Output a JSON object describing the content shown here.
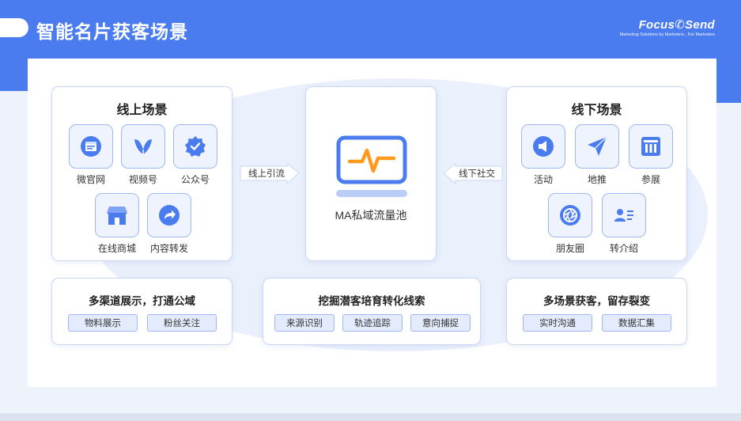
{
  "header": {
    "title": "智能名片获客场景",
    "brand": "Focus✆Send",
    "brand_tagline": "Marketing Solutions by Marketers , For Marketers"
  },
  "online": {
    "title": "线上场景",
    "items": [
      {
        "label": "微官网",
        "icon": "browser-icon"
      },
      {
        "label": "视频号",
        "icon": "butterfly-icon"
      },
      {
        "label": "公众号",
        "icon": "verified-badge-icon"
      },
      {
        "label": "在线商城",
        "icon": "store-icon"
      },
      {
        "label": "内容转发",
        "icon": "share-arrow-icon"
      }
    ]
  },
  "offline": {
    "title": "线下场景",
    "items": [
      {
        "label": "活动",
        "icon": "megaphone-icon"
      },
      {
        "label": "地推",
        "icon": "send-arrow-icon"
      },
      {
        "label": "参展",
        "icon": "exhibition-icon"
      },
      {
        "label": "朋友圈",
        "icon": "aperture-icon"
      },
      {
        "label": "转介绍",
        "icon": "contact-card-icon"
      }
    ]
  },
  "flow": {
    "left_arrow": "线上引流",
    "right_arrow": "线下社交",
    "center_label": "MA私域流量池",
    "center_icon": "monitor-pulse-icon"
  },
  "bottom": [
    {
      "title": "多渠道展示，打通公域",
      "tags": [
        "物料展示",
        "粉丝关注"
      ]
    },
    {
      "title": "挖掘潜客培育转化线索",
      "tags": [
        "来源识别",
        "轨迹追踪",
        "意向捕捉"
      ]
    },
    {
      "title": "多场景获客，留存裂变",
      "tags": [
        "实时沟通",
        "数据汇集"
      ]
    }
  ],
  "colors": {
    "brand_blue": "#4a7bef",
    "accent_orange": "#ff9a1f",
    "light_bg": "#eaf0fc"
  }
}
